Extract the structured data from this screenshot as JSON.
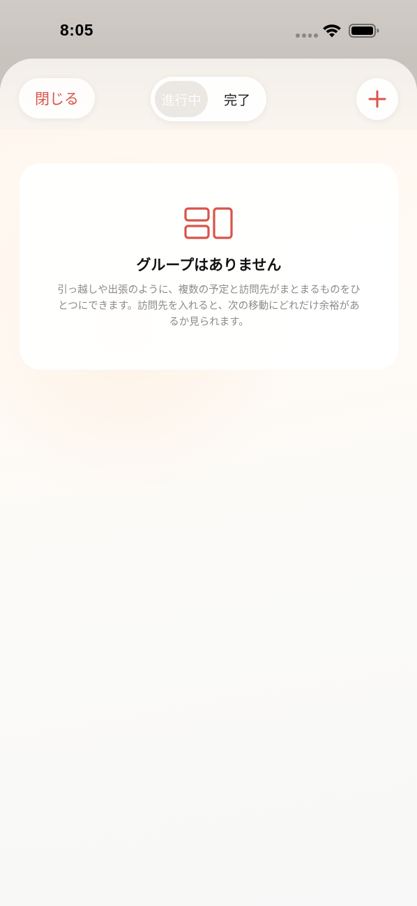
{
  "status_bar": {
    "time": "8:05",
    "icons": [
      "signal-dots-icon",
      "wifi-icon",
      "battery-icon"
    ]
  },
  "nav": {
    "close_label": "閉じる",
    "segments": [
      {
        "label": "進行中",
        "selected": true
      },
      {
        "label": "完了",
        "selected": false
      }
    ],
    "add_icon": "plus-icon"
  },
  "empty_state": {
    "icon": "group-layout-icon",
    "title": "グループはありません",
    "description": "引っ越しや出張のように、複数の予定と訪問先がまとまるものをひとつにできます。訪問先を入れると、次の移動にどれだけ余裕があるか見られます。"
  },
  "colors": {
    "accent": "#d9544a",
    "title": "#111111",
    "secondary_text": "#8b8b8b"
  }
}
